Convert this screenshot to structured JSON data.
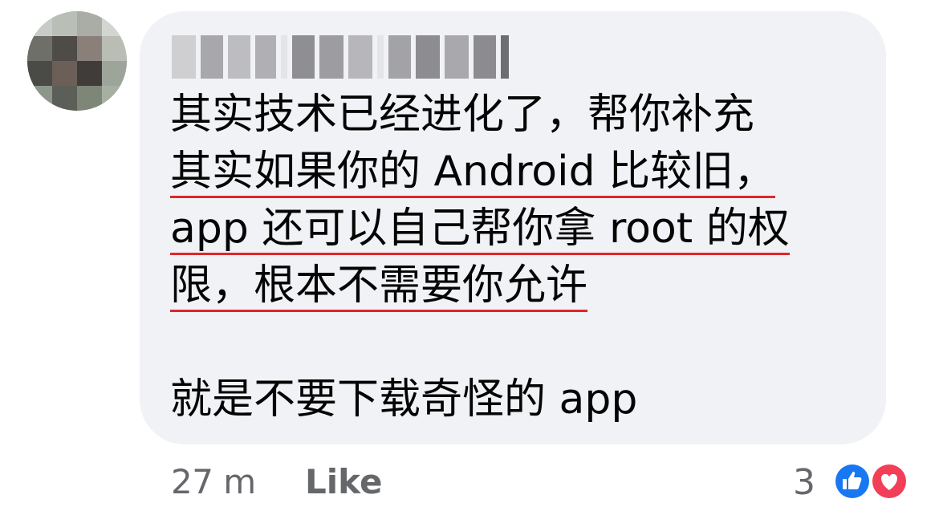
{
  "comment": {
    "lines": [
      "其实技术已经进化了，帮你补充",
      "其实如果你的 Android 比较旧，",
      "app 还可以自己帮你拿 root 的权",
      "限，根本不需要你允许",
      "就是不要下载奇怪的 app"
    ]
  },
  "footer": {
    "timestamp": "27 m",
    "like_label": "Like",
    "reaction_count": "3"
  },
  "reactions": [
    "like-icon",
    "love-icon"
  ],
  "colors": {
    "bubble": "#f0f2f5",
    "underline": "#e0262c",
    "like_blue": "#1877f2",
    "love_red": "#f33e58",
    "meta_gray": "#65676b"
  }
}
